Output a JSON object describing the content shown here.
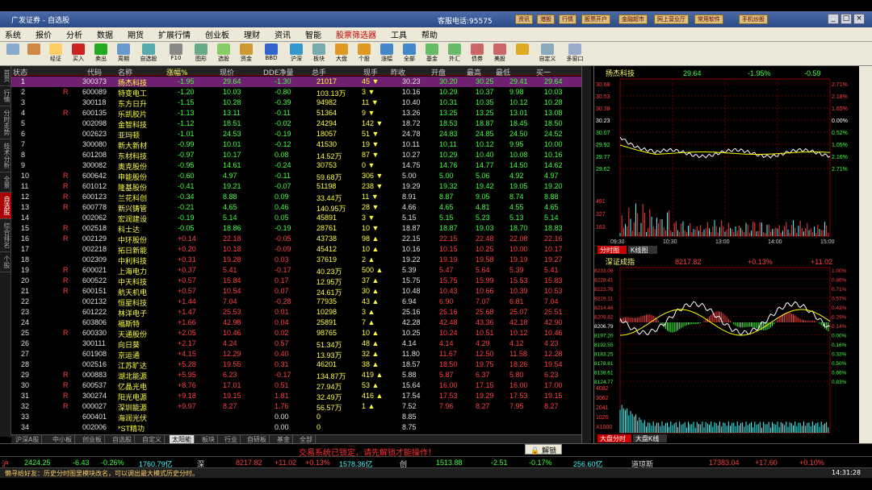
{
  "window": {
    "title": "广发证券 - 自选股",
    "hotline": "客服电话:95575",
    "title_buttons": [
      "资讯",
      "港股",
      "行情",
      "股票开户",
      "金融超市",
      "网上营业厅",
      "常用软件",
      "手机炒股"
    ]
  },
  "menu": [
    "系统",
    "报价",
    "分析",
    "数据",
    "期货",
    "扩展行情",
    "创业板",
    "理财",
    "资讯",
    "智能",
    "股票筛选器",
    "工具",
    "帮助"
  ],
  "toolbar": [
    "",
    "",
    "经证",
    "买入",
    "卖出",
    "周期",
    "自选股",
    "F10",
    "图形",
    "选股",
    "资金",
    "BBD",
    "沪深",
    "板块",
    "大盘",
    "个股",
    "涨幅",
    "全部",
    "基金",
    "外汇",
    "债券",
    "美股",
    "",
    "自定义",
    "多窗口"
  ],
  "side_tabs": [
    "首页",
    "行情",
    "分时走势",
    "技术分析",
    "全景",
    "自选股",
    "综合排名",
    "个股"
  ],
  "columns": [
    "状态",
    "代码",
    "名称",
    "涨幅%",
    "现价",
    "DDE净量",
    "总手",
    "现手",
    "昨收",
    "开盘",
    "最高",
    "最低",
    "买一"
  ],
  "rows": [
    {
      "n": "1",
      "f": "",
      "code": "300373",
      "name": "扬杰科技",
      "chg": "-1.95",
      "price": "29.64",
      "dde": "-1.30",
      "vol": "21017",
      "cur": "45",
      "prev": "30.23",
      "open": "30.20",
      "high": "30.25",
      "low": "29.41",
      "bid": "29.64",
      "d": "dn"
    },
    {
      "n": "2",
      "f": "R",
      "code": "600089",
      "name": "特变电工",
      "chg": "-1.20",
      "price": "10.03",
      "dde": "-0.80",
      "vol": "103.13万",
      "cur": "3",
      "prev": "10.16",
      "open": "10.29",
      "high": "10.37",
      "low": "9.98",
      "bid": "10.03",
      "d": "dn"
    },
    {
      "n": "3",
      "f": "",
      "code": "300118",
      "name": "东方日升",
      "chg": "-1.15",
      "price": "10.28",
      "dde": "-0.39",
      "vol": "94982",
      "cur": "11",
      "prev": "10.40",
      "open": "10.31",
      "high": "10.35",
      "low": "10.12",
      "bid": "10.28",
      "d": "dn"
    },
    {
      "n": "4",
      "f": "R",
      "code": "600135",
      "name": "乐凯胶片",
      "chg": "-1.13",
      "price": "13.11",
      "dde": "-0.11",
      "vol": "51364",
      "cur": "9",
      "prev": "13.26",
      "open": "13.25",
      "high": "13.25",
      "low": "13.01",
      "bid": "13.08",
      "d": "dn"
    },
    {
      "n": "5",
      "f": "",
      "code": "002098",
      "name": "金智科技",
      "chg": "-1.12",
      "price": "18.51",
      "dde": "-0.02",
      "vol": "24294",
      "cur": "142",
      "prev": "18.72",
      "open": "18.53",
      "high": "18.87",
      "low": "18.45",
      "bid": "18.50",
      "d": "dn"
    },
    {
      "n": "6",
      "f": "",
      "code": "002623",
      "name": "亚玛顿",
      "chg": "-1.01",
      "price": "24.53",
      "dde": "-0.19",
      "vol": "18057",
      "cur": "51",
      "prev": "24.78",
      "open": "24.83",
      "high": "24.85",
      "low": "24.50",
      "bid": "24.52",
      "d": "dn"
    },
    {
      "n": "7",
      "f": "",
      "code": "300080",
      "name": "新大新材",
      "chg": "-0.99",
      "price": "10.01",
      "dde": "-0.12",
      "vol": "41530",
      "cur": "19",
      "prev": "10.11",
      "open": "10.11",
      "high": "10.12",
      "low": "9.95",
      "bid": "10.00",
      "d": "dn"
    },
    {
      "n": "8",
      "f": "",
      "code": "601208",
      "name": "东材科技",
      "chg": "-0.97",
      "price": "10.17",
      "dde": "0.08",
      "vol": "14.52万",
      "cur": "87",
      "prev": "10.27",
      "open": "10.29",
      "high": "10.40",
      "low": "10.08",
      "bid": "10.16",
      "d": "dn"
    },
    {
      "n": "9",
      "f": "",
      "code": "300082",
      "name": "奥克股份",
      "chg": "-0.95",
      "price": "14.61",
      "dde": "-0.24",
      "vol": "30753",
      "cur": "0",
      "prev": "14.75",
      "open": "14.76",
      "high": "14.77",
      "low": "14.50",
      "bid": "14.62",
      "d": "dn"
    },
    {
      "n": "10",
      "f": "R",
      "code": "600642",
      "name": "申能股份",
      "chg": "-0.60",
      "price": "4.97",
      "dde": "-0.11",
      "vol": "59.68万",
      "cur": "306",
      "prev": "5.00",
      "open": "5.00",
      "high": "5.06",
      "low": "4.92",
      "bid": "4.97",
      "d": "dn"
    },
    {
      "n": "11",
      "f": "R",
      "code": "601012",
      "name": "隆基股份",
      "chg": "-0.41",
      "price": "19.21",
      "dde": "-0.07",
      "vol": "51198",
      "cur": "238",
      "prev": "19.29",
      "open": "19.32",
      "high": "19.42",
      "low": "19.05",
      "bid": "19.20",
      "d": "dn"
    },
    {
      "n": "12",
      "f": "R",
      "code": "600123",
      "name": "兰花科创",
      "chg": "-0.34",
      "price": "8.88",
      "dde": "0.09",
      "vol": "33.44万",
      "cur": "11",
      "prev": "8.91",
      "open": "8.87",
      "high": "9.05",
      "low": "8.74",
      "bid": "8.88",
      "d": "dn"
    },
    {
      "n": "13",
      "f": "R",
      "code": "600778",
      "name": "新兴铸管",
      "chg": "-0.21",
      "price": "4.65",
      "dde": "0.46",
      "vol": "140.95万",
      "cur": "28",
      "prev": "4.66",
      "open": "4.65",
      "high": "4.81",
      "low": "4.55",
      "bid": "4.65",
      "d": "dn"
    },
    {
      "n": "14",
      "f": "",
      "code": "002062",
      "name": "宏润建设",
      "chg": "-0.19",
      "price": "5.14",
      "dde": "0.05",
      "vol": "45891",
      "cur": "3",
      "prev": "5.15",
      "open": "5.15",
      "high": "5.23",
      "low": "5.13",
      "bid": "5.14",
      "d": "dn"
    },
    {
      "n": "15",
      "f": "R",
      "code": "002518",
      "name": "科士达",
      "chg": "-0.05",
      "price": "18.86",
      "dde": "-0.19",
      "vol": "28761",
      "cur": "10",
      "prev": "18.87",
      "open": "18.87",
      "high": "19.03",
      "low": "18.70",
      "bid": "18.83",
      "d": "dn"
    },
    {
      "n": "16",
      "f": "R",
      "code": "002129",
      "name": "中环股份",
      "chg": "+0.14",
      "price": "22.18",
      "dde": "-0.05",
      "vol": "43738",
      "cur": "98",
      "prev": "22.15",
      "open": "22.15",
      "high": "22.48",
      "low": "22.08",
      "bid": "22.16",
      "d": "up"
    },
    {
      "n": "17",
      "f": "",
      "code": "002218",
      "name": "拓日新能",
      "chg": "+0.20",
      "price": "10.18",
      "dde": "-0.09",
      "vol": "45412",
      "cur": "10",
      "prev": "10.16",
      "open": "10.15",
      "high": "10.25",
      "low": "10.00",
      "bid": "10.17",
      "d": "up"
    },
    {
      "n": "18",
      "f": "",
      "code": "002309",
      "name": "中利科技",
      "chg": "+0.31",
      "price": "19.28",
      "dde": "0.03",
      "vol": "37619",
      "cur": "2",
      "prev": "19.22",
      "open": "19.19",
      "high": "19.58",
      "low": "19.19",
      "bid": "19.27",
      "d": "up"
    },
    {
      "n": "19",
      "f": "R",
      "code": "600021",
      "name": "上海电力",
      "chg": "+0.37",
      "price": "5.41",
      "dde": "-0.17",
      "vol": "40.23万",
      "cur": "500",
      "prev": "5.39",
      "open": "5.47",
      "high": "5.64",
      "low": "5.39",
      "bid": "5.41",
      "d": "up"
    },
    {
      "n": "20",
      "f": "R",
      "code": "600522",
      "name": "中天科技",
      "chg": "+0.57",
      "price": "15.84",
      "dde": "0.17",
      "vol": "12.95万",
      "cur": "37",
      "prev": "15.75",
      "open": "15.75",
      "high": "15.99",
      "low": "15.53",
      "bid": "15.83",
      "d": "up"
    },
    {
      "n": "21",
      "f": "R",
      "code": "600151",
      "name": "航天机电",
      "chg": "+0.57",
      "price": "10.54",
      "dde": "0.07",
      "vol": "24.61万",
      "cur": "30",
      "prev": "10.48",
      "open": "10.43",
      "high": "10.66",
      "low": "10.39",
      "bid": "10.53",
      "d": "up"
    },
    {
      "n": "22",
      "f": "",
      "code": "002132",
      "name": "恒星科技",
      "chg": "+1.44",
      "price": "7.04",
      "dde": "-0.28",
      "vol": "77935",
      "cur": "43",
      "prev": "6.94",
      "open": "6.90",
      "high": "7.07",
      "low": "6.81",
      "bid": "7.04",
      "d": "up"
    },
    {
      "n": "23",
      "f": "",
      "code": "601222",
      "name": "林洋电子",
      "chg": "+1.47",
      "price": "25.53",
      "dde": "0.01",
      "vol": "10298",
      "cur": "3",
      "prev": "25.16",
      "open": "25.16",
      "high": "25.68",
      "low": "25.07",
      "bid": "25.51",
      "d": "up"
    },
    {
      "n": "24",
      "f": "",
      "code": "603806",
      "name": "福斯特",
      "chg": "+1.66",
      "price": "42.98",
      "dde": "0.04",
      "vol": "25891",
      "cur": "7",
      "prev": "42.28",
      "open": "42.48",
      "high": "43.36",
      "low": "42.18",
      "bid": "42.90",
      "d": "up"
    },
    {
      "n": "25",
      "f": "R",
      "code": "600330",
      "name": "天通股份",
      "chg": "+2.05",
      "price": "10.46",
      "dde": "0.02",
      "vol": "98765",
      "cur": "10",
      "prev": "10.25",
      "open": "10.24",
      "high": "10.51",
      "low": "10.12",
      "bid": "10.46",
      "d": "up"
    },
    {
      "n": "26",
      "f": "",
      "code": "300111",
      "name": "向日葵",
      "chg": "+2.17",
      "price": "4.24",
      "dde": "0.57",
      "vol": "51.34万",
      "cur": "48",
      "prev": "4.14",
      "open": "4.14",
      "high": "4.29",
      "low": "4.12",
      "bid": "4.23",
      "d": "up"
    },
    {
      "n": "27",
      "f": "",
      "code": "601908",
      "name": "京运通",
      "chg": "+4.15",
      "price": "12.29",
      "dde": "0.40",
      "vol": "13.93万",
      "cur": "32",
      "prev": "11.80",
      "open": "11.67",
      "high": "12.50",
      "low": "11.58",
      "bid": "12.28",
      "d": "up"
    },
    {
      "n": "28",
      "f": "",
      "code": "002516",
      "name": "江苏旷达",
      "chg": "+5.28",
      "price": "19.55",
      "dde": "0.31",
      "vol": "46201",
      "cur": "38",
      "prev": "18.57",
      "open": "18.50",
      "high": "19.75",
      "low": "18.26",
      "bid": "19.54",
      "d": "up"
    },
    {
      "n": "29",
      "f": "R",
      "code": "000883",
      "name": "湖北能源",
      "chg": "+5.95",
      "price": "6.23",
      "dde": "-0.17",
      "vol": "134.87万",
      "cur": "419",
      "prev": "5.88",
      "open": "5.87",
      "high": "6.37",
      "low": "5.80",
      "bid": "6.23",
      "d": "up"
    },
    {
      "n": "30",
      "f": "R",
      "code": "600537",
      "name": "亿晶光电",
      "chg": "+8.76",
      "price": "17.01",
      "dde": "0.51",
      "vol": "27.94万",
      "cur": "53",
      "prev": "15.64",
      "open": "16.00",
      "high": "17.15",
      "low": "16.00",
      "bid": "17.00",
      "d": "up"
    },
    {
      "n": "31",
      "f": "R",
      "code": "300274",
      "name": "阳光电源",
      "chg": "+9.18",
      "price": "19.15",
      "dde": "1.81",
      "vol": "32.49万",
      "cur": "416",
      "prev": "17.54",
      "open": "17.53",
      "high": "19.29",
      "low": "17.53",
      "bid": "19.15",
      "d": "up"
    },
    {
      "n": "32",
      "f": "R",
      "code": "000027",
      "name": "深圳能源",
      "chg": "+9.97",
      "price": "8.27",
      "dde": "1.76",
      "vol": "56.57万",
      "cur": "1",
      "prev": "7.52",
      "open": "7.96",
      "high": "8.27",
      "low": "7.95",
      "bid": "8.27",
      "d": "up"
    },
    {
      "n": "33",
      "f": "",
      "code": "600401",
      "name": "海润光伏",
      "chg": "",
      "price": "",
      "dde": "0.00",
      "vol": "0",
      "cur": "",
      "prev": "8.85",
      "open": "",
      "high": "",
      "low": "",
      "bid": "",
      "d": "flat"
    },
    {
      "n": "34",
      "f": "",
      "code": "002006",
      "name": "*ST精功",
      "chg": "",
      "price": "",
      "dde": "0.00",
      "vol": "0",
      "cur": "",
      "prev": "8.75",
      "open": "",
      "high": "",
      "low": "",
      "bid": "",
      "d": "flat"
    }
  ],
  "bottom_tabs": [
    "沪深A股",
    "中小板",
    "创业板",
    "自选股",
    "自定义",
    "太阳能",
    "板块",
    "行业",
    "自研板",
    "基金",
    "全部"
  ],
  "right": {
    "stock": {
      "name": "扬杰科技",
      "price": "29.64",
      "chg": "-1.95%",
      "diff": "-0.59"
    },
    "left_ticks": [
      "30.68",
      "30.53",
      "30.38",
      "30.23",
      "30.07",
      "29.92",
      "29.77",
      "29.62"
    ],
    "right_ticks": [
      "2.71%",
      "2.18%",
      "1.65%",
      "0.00%",
      "0.52%",
      "1.05%",
      "2.16%",
      "2.71%"
    ],
    "vol_ticks": [
      "491",
      "327",
      "163"
    ],
    "times": [
      "09:30",
      "10:30",
      "13:00",
      "14:00",
      "15:00"
    ],
    "tabs": [
      "分时图",
      "K线图"
    ],
    "index": {
      "name": "深证成指",
      "value": "8217.82",
      "chg": "+0.13%",
      "diff": "+11.02"
    },
    "idx_left": [
      "8233.06",
      "8228.41",
      "8223.76",
      "8219.11",
      "8214.46",
      "8209.82",
      "8206.79",
      "8197.20",
      "8192.55",
      "8183.25",
      "8178.61",
      "8138.61",
      "8124.77"
    ],
    "idx_right": [
      "1.00%",
      "0.86%",
      "0.71%",
      "0.57%",
      "0.43%",
      "0.29%",
      "0.14%",
      "0.00%",
      "0.16%",
      "0.33%",
      "0.50%",
      "0.66%",
      "0.83%"
    ],
    "idx_vol": [
      "4082",
      "3062",
      "2041",
      "1020",
      "X1000"
    ],
    "idx_tabs": [
      "大盘分时",
      "大盘K线"
    ]
  },
  "lock_msg": "交易系统已锁定，请先解锁才能操作！",
  "unlock": "解锁",
  "ticker": [
    {
      "t": "沪",
      "c": "r"
    },
    {
      "t": "2424.25",
      "c": "g"
    },
    {
      "t": "-6.43",
      "c": "g"
    },
    {
      "t": "-0.26%",
      "c": "g"
    },
    {
      "t": "1760.79亿",
      "c": "c"
    },
    {
      "t": "深",
      "c": "w"
    },
    {
      "t": "8217.82",
      "c": "r"
    },
    {
      "t": "+11.02",
      "c": "r"
    },
    {
      "t": "+0.13%",
      "c": "r"
    },
    {
      "t": "1578.36亿",
      "c": "c"
    },
    {
      "t": "创",
      "c": "w"
    },
    {
      "t": "1513.88",
      "c": "g"
    },
    {
      "t": "-2.51",
      "c": "g"
    },
    {
      "t": "-0.17%",
      "c": "g"
    },
    {
      "t": "256.60亿",
      "c": "c"
    },
    {
      "t": "道琼斯",
      "c": "w"
    },
    {
      "t": "17383.04",
      "c": "r"
    },
    {
      "t": "+17.60",
      "c": "r"
    },
    {
      "t": "+0.10%",
      "c": "r"
    }
  ],
  "bottom_bar": {
    "msg": "懒寻给好友：历史分时图里模块改名，可以调出最大模式历史分时。",
    "time": "14:31:28"
  }
}
